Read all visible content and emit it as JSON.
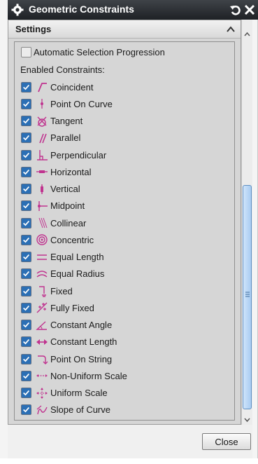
{
  "window": {
    "title": "Geometric Constraints"
  },
  "panel": {
    "title": "Settings"
  },
  "automatic_selection": {
    "label": "Automatic Selection Progression",
    "checked": false
  },
  "section_label": "Enabled Constraints:",
  "constraints": [
    {
      "label": "Coincident",
      "icon": "coincident-icon",
      "checked": true
    },
    {
      "label": "Point On Curve",
      "icon": "point-on-curve-icon",
      "checked": true
    },
    {
      "label": "Tangent",
      "icon": "tangent-icon",
      "checked": true
    },
    {
      "label": "Parallel",
      "icon": "parallel-icon",
      "checked": true
    },
    {
      "label": "Perpendicular",
      "icon": "perpendicular-icon",
      "checked": true
    },
    {
      "label": "Horizontal",
      "icon": "horizontal-icon",
      "checked": true
    },
    {
      "label": "Vertical",
      "icon": "vertical-icon",
      "checked": true
    },
    {
      "label": "Midpoint",
      "icon": "midpoint-icon",
      "checked": true
    },
    {
      "label": "Collinear",
      "icon": "collinear-icon",
      "checked": true
    },
    {
      "label": "Concentric",
      "icon": "concentric-icon",
      "checked": true
    },
    {
      "label": "Equal Length",
      "icon": "equal-length-icon",
      "checked": true
    },
    {
      "label": "Equal Radius",
      "icon": "equal-radius-icon",
      "checked": true
    },
    {
      "label": "Fixed",
      "icon": "fixed-icon",
      "checked": true
    },
    {
      "label": "Fully Fixed",
      "icon": "fully-fixed-icon",
      "checked": true
    },
    {
      "label": "Constant Angle",
      "icon": "constant-angle-icon",
      "checked": true
    },
    {
      "label": "Constant Length",
      "icon": "constant-length-icon",
      "checked": true
    },
    {
      "label": "Point On String",
      "icon": "point-on-string-icon",
      "checked": true
    },
    {
      "label": "Non-Uniform Scale",
      "icon": "non-uniform-scale-icon",
      "checked": true
    },
    {
      "label": "Uniform Scale",
      "icon": "uniform-scale-icon",
      "checked": true
    },
    {
      "label": "Slope of Curve",
      "icon": "slope-of-curve-icon",
      "checked": true
    }
  ],
  "footer": {
    "close_label": "Close"
  },
  "colors": {
    "titlebar": "#2a2d31",
    "checkbox_checked": "#2b6fb5",
    "constraint_icon": "#c0338f",
    "scroll_thumb": "#a9cdf2"
  }
}
